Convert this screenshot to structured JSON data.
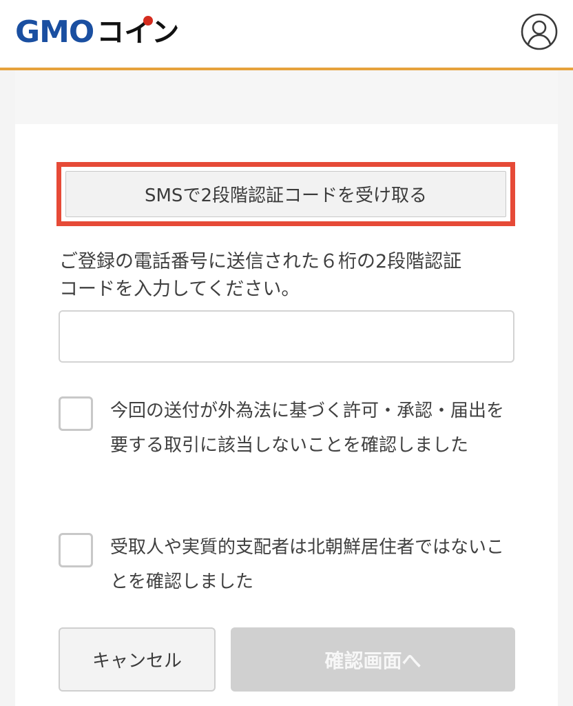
{
  "header": {
    "logo_gmo": "GMO",
    "logo_coin": "コイン",
    "avatar_icon": "user-circle-icon",
    "accent_color": "#e6a23c"
  },
  "sms_button": {
    "label": "SMSで2段階認証コードを受け取る",
    "highlight_color": "#e64a37"
  },
  "instruction": {
    "line1": "ご登録の電話番号に送信された６桁の2段階認証",
    "line2": "コードを入力してください。"
  },
  "code_input": {
    "value": "",
    "placeholder": ""
  },
  "checks": [
    {
      "label": "今回の送付が外為法に基づく許可・承認・届出を要する取引に該当しないことを確認しました",
      "checked": false
    },
    {
      "label": "受取人や実質的支配者は北朝鮮居住者ではないことを確認しました",
      "checked": false
    }
  ],
  "buttons": {
    "cancel_label": "キャンセル",
    "confirm_label": "確認画面へ"
  }
}
